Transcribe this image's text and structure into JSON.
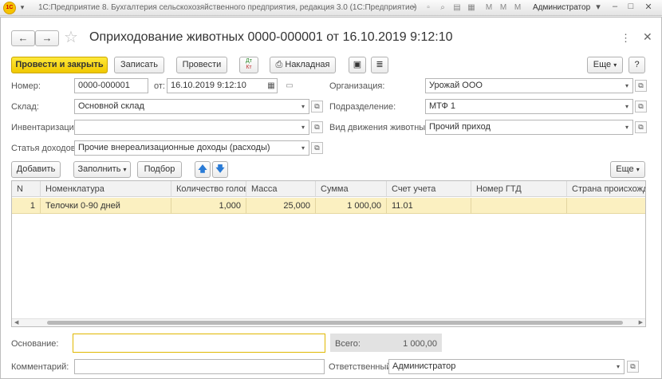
{
  "app": {
    "logo": "1С",
    "title": "1С:Предприятие 8. Бухгалтерия сельскохозяйственного предприятия, редакция 3.0  (1С:Предприятие)",
    "user": "Администратор"
  },
  "nav": {
    "back": "←",
    "forward": "→"
  },
  "document": {
    "title": "Оприходование животных 0000-000001 от 16.10.2019 9:12:10"
  },
  "toolbar": {
    "post_and_close": "Провести и закрыть",
    "save": "Записать",
    "post": "Провести",
    "dtkt_dt": "Дт",
    "dtkt_kt": "Кт",
    "waybill": "Накладная",
    "more": "Еще",
    "help": "?"
  },
  "form": {
    "number_label": "Номер:",
    "number_value": "0000-000001",
    "date_label": "от:",
    "date_value": "16.10.2019  9:12:10",
    "warehouse_label": "Склад:",
    "warehouse_value": "Основной склад",
    "inventory_label": "Инвентаризация:",
    "inventory_value": "",
    "income_label": "Статья доходов:",
    "income_value": "Прочие внереализационные доходы (расходы)",
    "org_label": "Организация:",
    "org_value": "Урожай ООО",
    "division_label": "Подразделение:",
    "division_value": "МТФ 1",
    "movement_label": "Вид движения животных:",
    "movement_value": "Прочий приход"
  },
  "table_toolbar": {
    "add": "Добавить",
    "fill": "Заполнить",
    "select": "Подбор",
    "more": "Еще"
  },
  "table": {
    "columns": [
      "N",
      "Номенклатура",
      "Количество голов",
      "Масса",
      "Сумма",
      "Счет учета",
      "Номер ГТД",
      "Страна происхождения"
    ],
    "rows": [
      {
        "n": "1",
        "item": "Телочки 0-90 дней",
        "qty": "1,000",
        "mass": "25,000",
        "sum": "1 000,00",
        "account": "11.01",
        "gtd": "",
        "country": ""
      }
    ]
  },
  "footer": {
    "basis_label": "Основание:",
    "basis_value": "",
    "total_label": "Всего:",
    "total_value": "1 000,00",
    "comment_label": "Комментарий:",
    "comment_value": "",
    "responsible_label": "Ответственный:",
    "responsible_value": "Администратор"
  }
}
